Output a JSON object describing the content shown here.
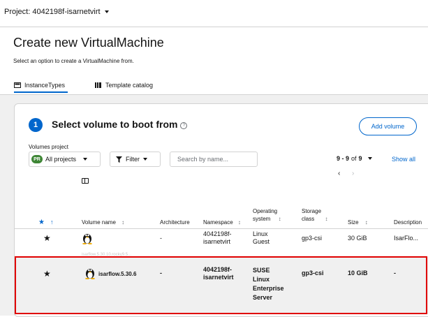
{
  "project_bar": {
    "label": "Project: 4042198f-isarnetvirt"
  },
  "page": {
    "title": "Create new VirtualMachine",
    "subtitle": "Select an option to create a VirtualMachine from."
  },
  "tabs": [
    {
      "label": "InstanceTypes",
      "icon": "instancetypes-icon",
      "active": true
    },
    {
      "label": "Template catalog",
      "icon": "catalog-icon",
      "active": false
    }
  ],
  "step": {
    "number": "1",
    "title": "Select volume to boot from",
    "add_volume": "Add volume"
  },
  "toolbar": {
    "volumes_project_label": "Volumes project",
    "project_badge": "PR",
    "project_value": "All projects",
    "filter_label": "Filter",
    "search_placeholder": "Search by name...",
    "pagination_range": "9 - 9",
    "pagination_of": "of",
    "pagination_total": "9",
    "show_all": "Show all",
    "prev": "‹",
    "next": "›"
  },
  "table": {
    "columns": {
      "volume_name": "Volume name",
      "architecture": "Architecture",
      "namespace": "Namespace",
      "os_line1": "Operating",
      "os_line2": "system",
      "storage_line1": "Storage",
      "storage_line2": "class",
      "size": "Size",
      "description": "Description"
    },
    "rows": [
      {
        "name": "",
        "name_faded": "isarflow.5.30.10.rocky9.5...",
        "architecture": "-",
        "namespace_l1": "4042198f-",
        "namespace_l2": "isarnetvirt",
        "os_l1": "Linux",
        "os_l2": "Guest",
        "os_l3": "",
        "os_l4": "",
        "storage_class": "gp3-csi",
        "size": "30 GiB",
        "description": "IsarFlo..."
      },
      {
        "name": "isarflow.5.30.6",
        "architecture": "-",
        "namespace_l1": "4042198f-",
        "namespace_l2": "isarnetvirt",
        "os_l1": "SUSE",
        "os_l2": "Linux",
        "os_l3": "Enterprise",
        "os_l4": "Server",
        "storage_class": "gp3-csi",
        "size": "10 GiB",
        "description": "-"
      }
    ]
  },
  "colors": {
    "accent": "#0066cc",
    "highlight": "#e00000",
    "success": "#3e8635"
  }
}
